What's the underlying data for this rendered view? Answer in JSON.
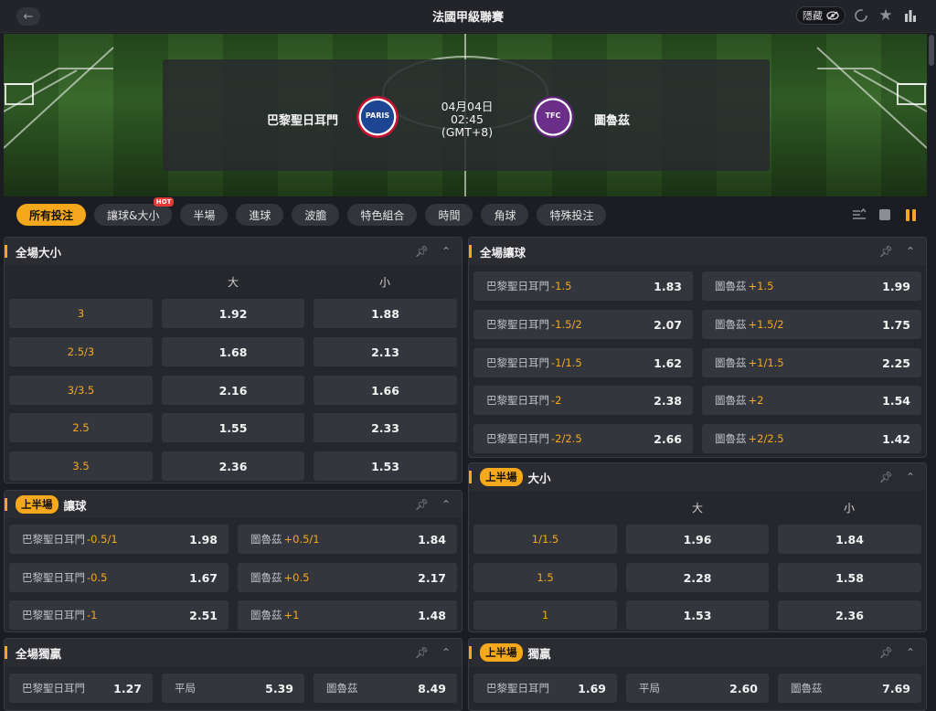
{
  "header": {
    "back_icon": "arrow-left-icon",
    "title": "法國甲級聯賽",
    "hide_label": "隱藏"
  },
  "match": {
    "home_team": "巴黎聖日耳門",
    "home_crest_text": "PARIS",
    "away_team": "圖魯茲",
    "away_crest_text": "TFC",
    "date": "04月04日",
    "time": "02:45",
    "timezone": "(GMT+8)"
  },
  "tabs": [
    {
      "label": "所有投注"
    },
    {
      "label": "讓球&大小",
      "badge": "HOT"
    },
    {
      "label": "半場"
    },
    {
      "label": "進球"
    },
    {
      "label": "波膽"
    },
    {
      "label": "特色組合"
    },
    {
      "label": "時間"
    },
    {
      "label": "角球"
    },
    {
      "label": "特殊投注"
    }
  ],
  "full_ou": {
    "title": "全場大小",
    "over": "大",
    "under": "小",
    "rows": [
      {
        "line": "3",
        "over": "1.92",
        "under": "1.88"
      },
      {
        "line": "2.5/3",
        "over": "1.68",
        "under": "2.13"
      },
      {
        "line": "3/3.5",
        "over": "2.16",
        "under": "1.66"
      },
      {
        "line": "2.5",
        "over": "1.55",
        "under": "2.33"
      },
      {
        "line": "3.5",
        "over": "2.36",
        "under": "1.53"
      }
    ]
  },
  "full_hc": {
    "title": "全場讓球",
    "rows": [
      {
        "home": "巴黎聖日耳門",
        "home_line": "-1.5",
        "home_odds": "1.83",
        "away": "圖魯茲",
        "away_line": "+1.5",
        "away_odds": "1.99"
      },
      {
        "home": "巴黎聖日耳門",
        "home_line": "-1.5/2",
        "home_odds": "2.07",
        "away": "圖魯茲",
        "away_line": "+1.5/2",
        "away_odds": "1.75"
      },
      {
        "home": "巴黎聖日耳門",
        "home_line": "-1/1.5",
        "home_odds": "1.62",
        "away": "圖魯茲",
        "away_line": "+1/1.5",
        "away_odds": "2.25"
      },
      {
        "home": "巴黎聖日耳門",
        "home_line": "-2",
        "home_odds": "2.38",
        "away": "圖魯茲",
        "away_line": "+2",
        "away_odds": "1.54"
      },
      {
        "home": "巴黎聖日耳門",
        "home_line": "-2/2.5",
        "home_odds": "2.66",
        "away": "圖魯茲",
        "away_line": "+2/2.5",
        "away_odds": "1.42"
      }
    ]
  },
  "half_hc": {
    "badge": "上半場",
    "title": "讓球",
    "rows": [
      {
        "home": "巴黎聖日耳門",
        "home_line": "-0.5/1",
        "home_odds": "1.98",
        "away": "圖魯茲",
        "away_line": "+0.5/1",
        "away_odds": "1.84"
      },
      {
        "home": "巴黎聖日耳門",
        "home_line": "-0.5",
        "home_odds": "1.67",
        "away": "圖魯茲",
        "away_line": "+0.5",
        "away_odds": "2.17"
      },
      {
        "home": "巴黎聖日耳門",
        "home_line": "-1",
        "home_odds": "2.51",
        "away": "圖魯茲",
        "away_line": "+1",
        "away_odds": "1.48"
      }
    ]
  },
  "half_ou": {
    "badge": "上半場",
    "title": "大小",
    "over": "大",
    "under": "小",
    "rows": [
      {
        "line": "1/1.5",
        "over": "1.96",
        "under": "1.84"
      },
      {
        "line": "1.5",
        "over": "2.28",
        "under": "1.58"
      },
      {
        "line": "1",
        "over": "1.53",
        "under": "2.36"
      }
    ]
  },
  "full_1x2": {
    "title": "全場獨贏",
    "row": {
      "home": "巴黎聖日耳門",
      "home_odds": "1.27",
      "draw": "平局",
      "draw_odds": "5.39",
      "away": "圖魯茲",
      "away_odds": "8.49"
    }
  },
  "half_1x2": {
    "badge": "上半場",
    "title": "獨贏",
    "row": {
      "home": "巴黎聖日耳門",
      "home_odds": "1.69",
      "draw": "平局",
      "draw_odds": "2.60",
      "away": "圖魯茲",
      "away_odds": "7.69"
    }
  },
  "colors": {
    "accent": "#f5a81c",
    "panel": "#26272c",
    "cell": "#34363d"
  }
}
